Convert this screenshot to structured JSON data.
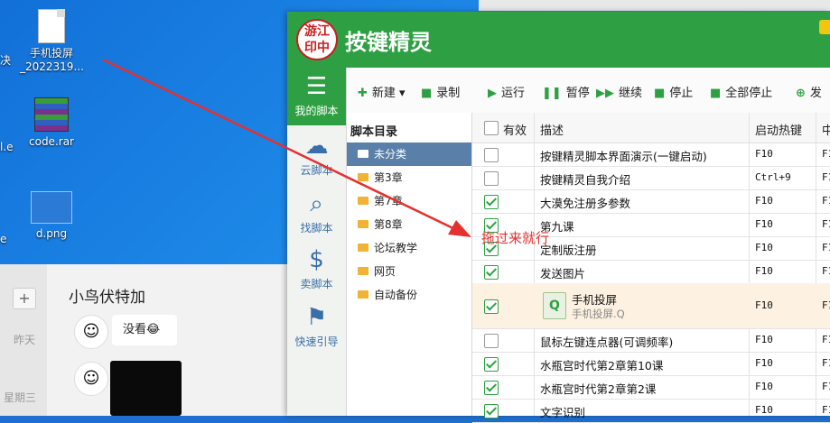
{
  "desktop": {
    "icons": [
      {
        "label": "手机投屏\n_2022319...",
        "icon": "document-file-icon"
      },
      {
        "label": "code.rar",
        "icon": "winrar-archive-icon"
      },
      {
        "label": "d.png",
        "icon": "image-file-icon"
      }
    ],
    "left_stubs": [
      "决",
      "l.e",
      "e"
    ]
  },
  "chat": {
    "plus": "+",
    "contact_name": "小鸟伏特加",
    "days": [
      "昨天",
      "星期三"
    ],
    "message_text": "没看",
    "message_emoji": "😂"
  },
  "app": {
    "title": "按键精灵",
    "seal_text": [
      "游江",
      "印中"
    ],
    "sidebar": [
      {
        "label": "我的脚本",
        "icon": "list-icon",
        "active": true
      },
      {
        "label": "云脚本",
        "icon": "cloud-icon"
      },
      {
        "label": "找脚本",
        "icon": "search-icon"
      },
      {
        "label": "卖脚本",
        "icon": "dollar-icon"
      },
      {
        "label": "快速引导",
        "icon": "signpost-icon"
      }
    ],
    "toolbar": [
      {
        "label": "新建",
        "icon": "plus-icon",
        "glyph": "✚"
      },
      {
        "label": "录制",
        "icon": "video-camera-icon",
        "glyph": "■"
      },
      {
        "label": "运行",
        "icon": "play-icon",
        "glyph": "▶"
      },
      {
        "label": "暂停",
        "icon": "pause-icon",
        "glyph": "❚❚"
      },
      {
        "label": "继续",
        "icon": "fast-forward-icon",
        "glyph": "▶▶"
      },
      {
        "label": "停止",
        "icon": "stop-icon",
        "glyph": "■"
      },
      {
        "label": "全部停止",
        "icon": "stop-all-icon",
        "glyph": "■"
      },
      {
        "label": "发",
        "icon": "publish-icon",
        "glyph": "⊕"
      }
    ],
    "tree": {
      "header": "脚本目录",
      "items": [
        "未分类",
        "第3章",
        "第7章",
        "第8章",
        "论坛教学",
        "网页",
        "自动备份"
      ]
    },
    "table": {
      "headers": {
        "valid": "有效",
        "desc": "描述",
        "hotkey": "启动热键",
        "last": "中"
      },
      "rows": [
        {
          "checked": false,
          "desc": "按键精灵脚本界面演示(一键启动)",
          "hotkey": "F10",
          "last": "F1"
        },
        {
          "checked": false,
          "desc": "按键精灵自我介绍",
          "hotkey": "Ctrl+9",
          "last": "F1"
        },
        {
          "checked": true,
          "desc": "大漠免注册多参数",
          "hotkey": "F10",
          "last": "F1"
        },
        {
          "checked": true,
          "desc": "第九课",
          "hotkey": "F10",
          "last": "F1"
        },
        {
          "checked": true,
          "desc": "定制版注册",
          "hotkey": "F10",
          "last": "F1"
        },
        {
          "checked": true,
          "desc": "发送图片",
          "hotkey": "F10",
          "last": "F1"
        },
        {
          "checked": true,
          "desc": "手机投屏",
          "sub": "手机投屏.Q",
          "hotkey": "F10",
          "last": "F1",
          "highlight": true
        },
        {
          "checked": false,
          "desc": "鼠标左键连点器(可调频率)",
          "hotkey": "F10",
          "last": "F1"
        },
        {
          "checked": true,
          "desc": "水瓶宫时代第2章第10课",
          "hotkey": "F10",
          "last": "F1"
        },
        {
          "checked": true,
          "desc": "水瓶宫时代第2章第2课",
          "hotkey": "F10",
          "last": "F1"
        },
        {
          "checked": true,
          "desc": "文字识别",
          "hotkey": "F10",
          "last": "F1"
        }
      ]
    }
  },
  "annotation": {
    "text": "拖过来就行",
    "color": "#e53030"
  },
  "colors": {
    "brand_green": "#2ea043",
    "selected_folder": "#5a7fa8",
    "highlight_row": "#fdf2e1"
  }
}
